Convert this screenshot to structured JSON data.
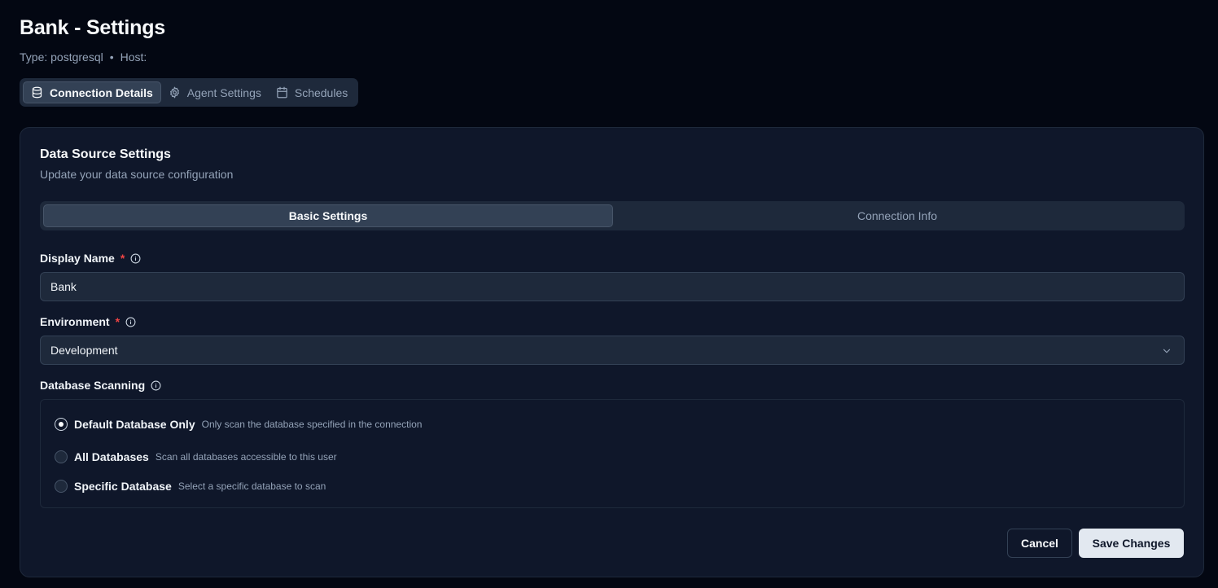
{
  "header": {
    "title": "Bank - Settings",
    "type_label": "Type: postgresql",
    "separator": "•",
    "host_label": "Host:"
  },
  "top_tabs": [
    {
      "label": "Connection Details",
      "icon": "database-icon",
      "active": true
    },
    {
      "label": "Agent Settings",
      "icon": "gear-icon",
      "active": false
    },
    {
      "label": "Schedules",
      "icon": "calendar-icon",
      "active": false
    }
  ],
  "card": {
    "title": "Data Source Settings",
    "subtitle": "Update your data source configuration"
  },
  "inner_tabs": [
    {
      "label": "Basic Settings",
      "active": true
    },
    {
      "label": "Connection Info",
      "active": false
    }
  ],
  "form": {
    "display_name": {
      "label": "Display Name",
      "required_mark": "*",
      "value": "Bank"
    },
    "environment": {
      "label": "Environment",
      "required_mark": "*",
      "value": "Development"
    },
    "scanning": {
      "label": "Database Scanning",
      "options": [
        {
          "title": "Default Database Only",
          "desc": "Only scan the database specified in the connection",
          "checked": true
        },
        {
          "title": "All Databases",
          "desc": "Scan all databases accessible to this user",
          "checked": false
        },
        {
          "title": "Specific Database",
          "desc": "Select a specific database to scan",
          "checked": false
        }
      ]
    }
  },
  "actions": {
    "cancel_label": "Cancel",
    "save_label": "Save Changes"
  },
  "colors": {
    "background": "#030712",
    "card": "#0f172a",
    "required": "#ef4444",
    "primary_button": "#e2e8f0"
  }
}
